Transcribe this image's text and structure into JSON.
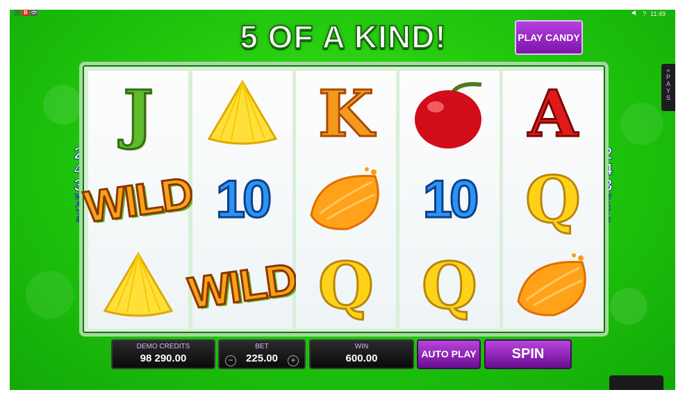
{
  "topbar": {
    "left_icons": [
      "status-icon-a",
      "R",
      "wifi-icon"
    ],
    "sound_icon": "speaker-icon",
    "help_label": "?",
    "time": "11:49"
  },
  "banner": {
    "text": "5 OF A KIND!"
  },
  "buttons": {
    "play_candy": "PLAY CANDY",
    "auto_play": "AUTO PLAY",
    "spin": "SPIN",
    "minus": "−",
    "plus": "+"
  },
  "ways": {
    "number": [
      "2",
      "4",
      "3"
    ],
    "label": [
      "W",
      "A",
      "Y",
      "S"
    ]
  },
  "pays_tab": {
    "arrow": "«",
    "label": [
      "P",
      "A",
      "Y",
      "S"
    ]
  },
  "reels": [
    [
      {
        "symbol": "J"
      },
      {
        "symbol": "WILD"
      },
      {
        "symbol": "pineapple"
      }
    ],
    [
      {
        "symbol": "pineapple"
      },
      {
        "symbol": "10"
      },
      {
        "symbol": "WILD"
      }
    ],
    [
      {
        "symbol": "K"
      },
      {
        "symbol": "orange"
      },
      {
        "symbol": "Q"
      }
    ],
    [
      {
        "symbol": "cherry"
      },
      {
        "symbol": "10"
      },
      {
        "symbol": "Q"
      }
    ],
    [
      {
        "symbol": "A"
      },
      {
        "symbol": "Q"
      },
      {
        "symbol": "orange"
      }
    ]
  ],
  "display": {
    "credits_label": "DEMO CREDITS",
    "credits_value": "98 290.00",
    "bet_label": "BET",
    "bet_value": "225.00",
    "win_label": "WIN",
    "win_value": "600.00"
  },
  "colors": {
    "background_green": "#1ec40c",
    "button_purple": "#8a1fb8",
    "panel_black": "#141414"
  }
}
